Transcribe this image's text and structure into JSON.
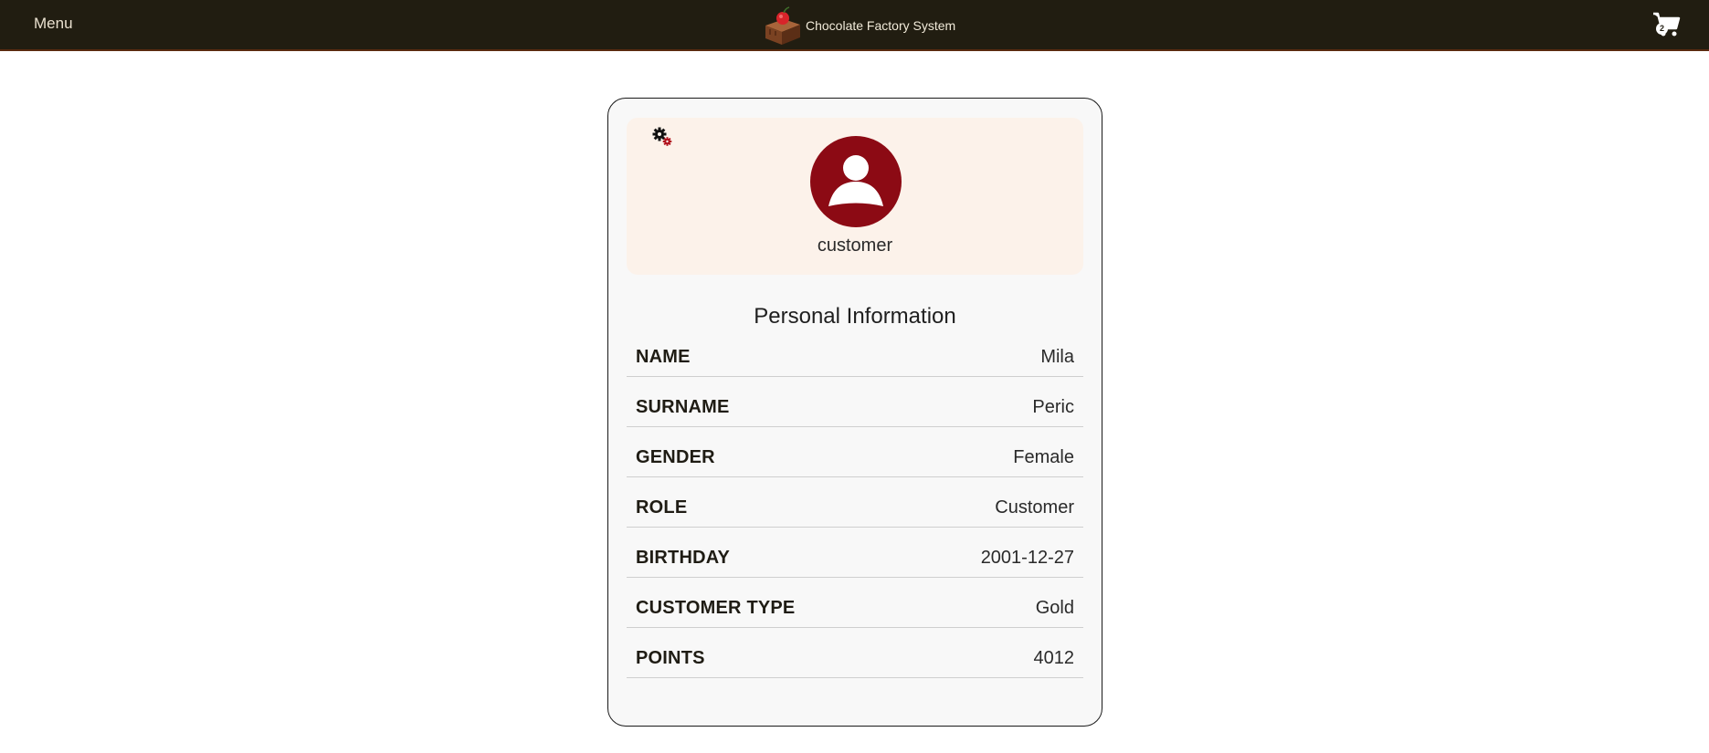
{
  "navbar": {
    "menu_label": "Menu",
    "brand_title": "Chocolate Factory System",
    "brand_logo_icon": "chocolate-cake-cherry-icon",
    "cart_icon": "shopping-cart-icon",
    "cart_count": "2"
  },
  "profile": {
    "settings_icon": "gears-icon",
    "avatar_icon": "user-avatar-icon",
    "role_label": "customer",
    "section_title": "Personal Information",
    "fields": [
      {
        "key": "NAME",
        "value": "Mila"
      },
      {
        "key": "SURNAME",
        "value": "Peric"
      },
      {
        "key": "GENDER",
        "value": "Female"
      },
      {
        "key": "ROLE",
        "value": "Customer"
      },
      {
        "key": "BIRTHDAY",
        "value": "2001-12-27"
      },
      {
        "key": "CUSTOMER TYPE",
        "value": "Gold"
      },
      {
        "key": "POINTS",
        "value": "4012"
      }
    ]
  },
  "colors": {
    "navbar_bg": "#211d11",
    "avatar_bg": "#8c0a14",
    "header_bg": "#fcf2ea",
    "card_bg": "#f8f8f8"
  }
}
